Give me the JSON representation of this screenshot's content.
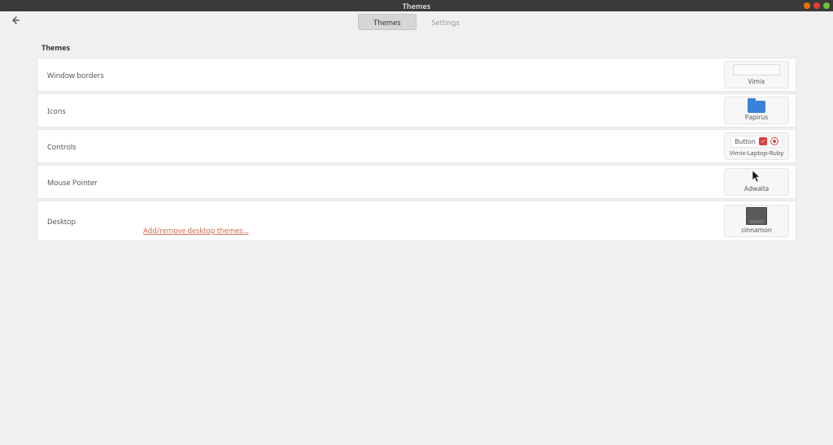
{
  "window": {
    "title": "Themes"
  },
  "tabs": {
    "themes": "Themes",
    "settings": "Settings",
    "active": "themes"
  },
  "section_title": "Themes",
  "rows": {
    "window_borders": {
      "label": "Window borders",
      "value": "Vimix"
    },
    "icons": {
      "label": "Icons",
      "value": "Papirus"
    },
    "controls": {
      "label": "Controls",
      "value": "Vimix-Laptop-Ruby",
      "sample_button": "Button"
    },
    "mouse_pointer": {
      "label": "Mouse Pointer",
      "value": "Adwaita"
    },
    "desktop": {
      "label": "Desktop",
      "value": "cinnamon"
    }
  },
  "link": "Add/remove desktop themes..."
}
